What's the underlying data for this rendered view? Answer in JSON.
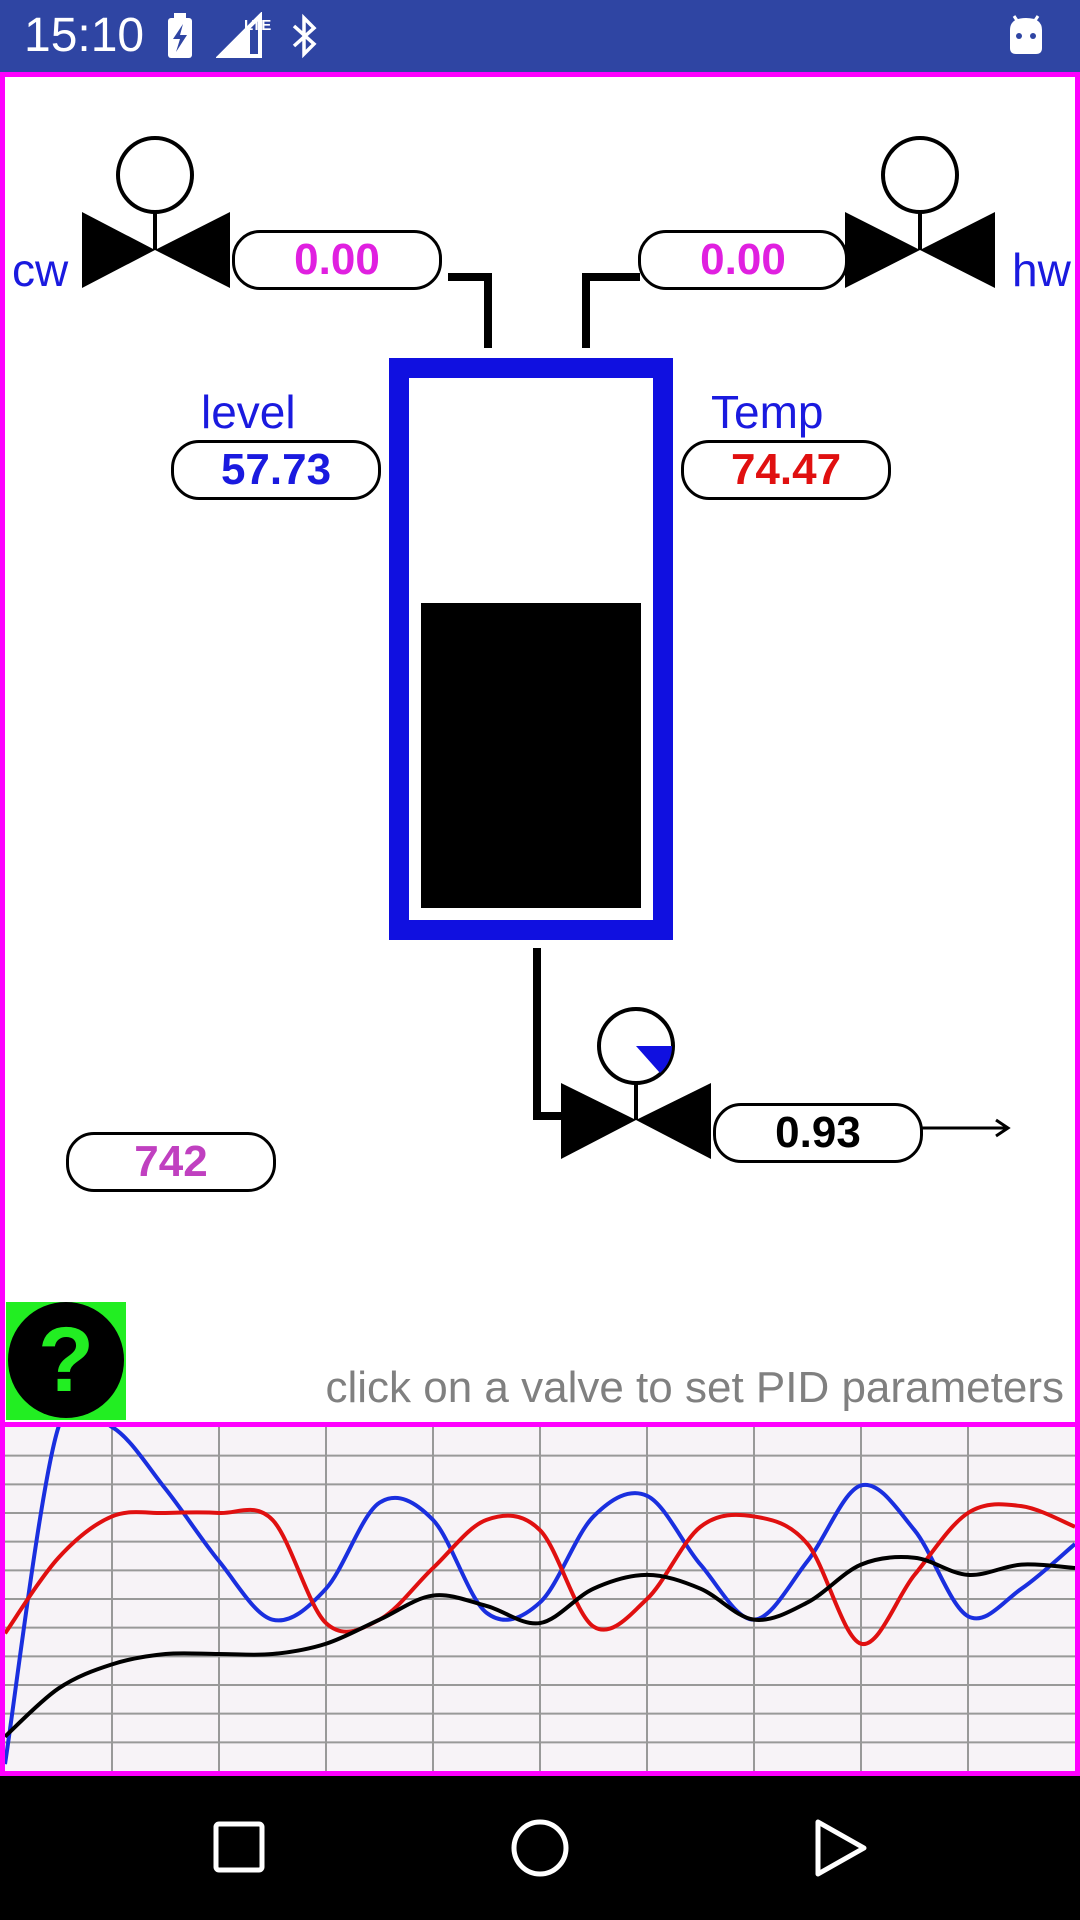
{
  "status_bar": {
    "time": "15:10",
    "icons": [
      "battery-charging-icon",
      "lte-signal-icon",
      "bluetooth-icon",
      "android-debug-icon"
    ]
  },
  "plant": {
    "cold_water": {
      "label": "cw",
      "flow": "0.00"
    },
    "hot_water": {
      "label": "hw",
      "flow": "0.00"
    },
    "level": {
      "label": "level",
      "value": "57.73",
      "fill_fraction": 0.5773
    },
    "temperature": {
      "label": "Temp",
      "value": "74.47"
    },
    "outlet": {
      "flow": "0.93"
    },
    "counter": "742"
  },
  "help": {
    "glyph": "?"
  },
  "hint": "click on a valve to set PID parameters",
  "colors": {
    "frame": "#ff00ff",
    "tank": "#1010e0",
    "flow_value": "#e020e0",
    "level_value": "#1a1adf",
    "temp_value": "#e01010",
    "counter_value": "#c040c0",
    "help_bg": "#22ee22",
    "grid": "#999999",
    "series_level": "#1a2fdf",
    "series_temp": "#e01010",
    "series_outlet": "#000000"
  },
  "chart_data": {
    "type": "line",
    "title": "",
    "xlabel": "",
    "ylabel": "",
    "grid": true,
    "x": [
      0,
      1,
      2,
      3,
      4,
      5,
      6,
      7,
      8,
      9,
      10,
      11,
      12,
      13,
      14,
      15,
      16,
      17,
      18,
      19,
      20
    ],
    "ylim": [
      0,
      100
    ],
    "series": [
      {
        "color": "#1a2fdf",
        "values": [
          2,
          100,
          100,
          82,
          61,
          44,
          53,
          78,
          73,
          46,
          49,
          74,
          80,
          60,
          44,
          61,
          83,
          70,
          45,
          53,
          66
        ]
      },
      {
        "color": "#e01010",
        "values": [
          40,
          62,
          74,
          75,
          75,
          73,
          43,
          44,
          59,
          73,
          70,
          42,
          50,
          71,
          74,
          66,
          37,
          57,
          75,
          77,
          71
        ]
      },
      {
        "color": "#000000",
        "values": [
          10,
          24,
          31,
          34,
          34,
          34,
          37,
          44,
          51,
          48,
          43,
          53,
          57,
          53,
          44,
          49,
          60,
          62,
          57,
          60,
          59
        ]
      }
    ]
  }
}
